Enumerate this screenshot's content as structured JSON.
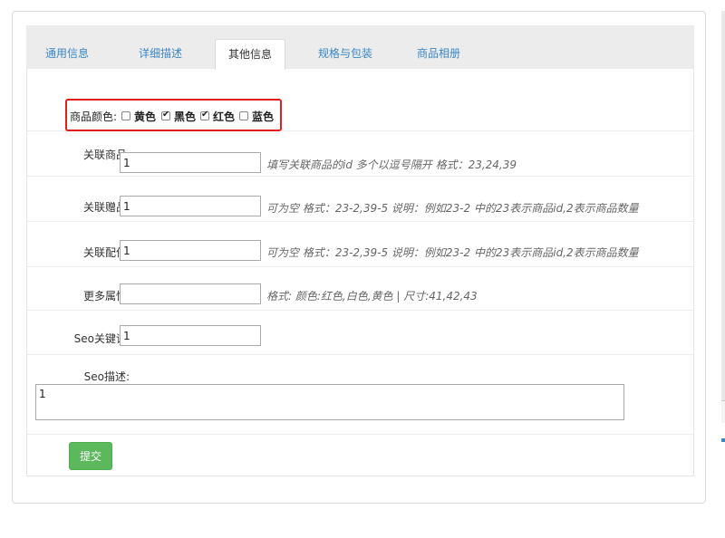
{
  "tabs": [
    {
      "label": "通用信息",
      "active": false
    },
    {
      "label": "详细描述",
      "active": false
    },
    {
      "label": "其他信息",
      "active": true
    },
    {
      "label": "规格与包装",
      "active": false
    },
    {
      "label": "商品相册",
      "active": false
    }
  ],
  "colors": {
    "label": "商品颜色:",
    "options": [
      {
        "label": "黄色",
        "checked": false
      },
      {
        "label": "黑色",
        "checked": true
      },
      {
        "label": "红色",
        "checked": true
      },
      {
        "label": "蓝色",
        "checked": false
      }
    ]
  },
  "related_goods": {
    "label": "关联商品:",
    "value": "1",
    "hint": "填写关联商品的id 多个以逗号隔开 格式：23,24,39"
  },
  "related_gifts": {
    "label": "关联赠品:",
    "value": "1",
    "hint": "可为空 格式：23-2,39-5 说明：例如23-2 中的23表示商品id,2表示商品数量"
  },
  "related_parts": {
    "label": "关联配件:",
    "value": "1",
    "hint": "可为空 格式：23-2,39-5 说明：例如23-2 中的23表示商品id,2表示商品数量"
  },
  "more_attrs": {
    "label": "更多属性:",
    "value": "",
    "hint": "格式: 颜色:红色,白色,黄色 | 尺寸:41,42,43"
  },
  "seo_keywords": {
    "label": "Seo关键词:",
    "value": "1"
  },
  "seo_desc": {
    "label": "Seo描述:",
    "value": "1"
  },
  "submit_label": "提交",
  "accent_colors": {
    "tab_link": "#3a87c8",
    "highlight_border": "#e02020",
    "submit_bg": "#5cb85c"
  }
}
